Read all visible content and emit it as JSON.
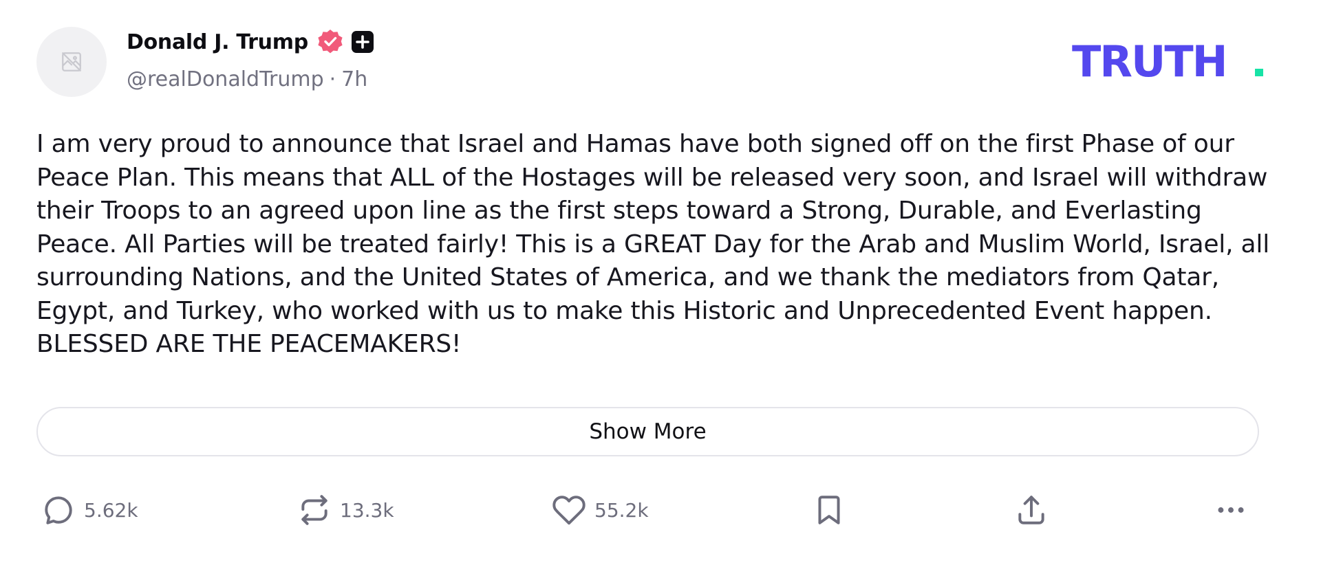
{
  "author": {
    "display_name": "Donald J. Trump",
    "handle": "@realDonaldTrump",
    "separator": "·",
    "timestamp": "7h",
    "avatar_icon": "broken-image-icon",
    "badges": [
      "verified-badge-icon",
      "plus-badge-icon"
    ]
  },
  "brand": {
    "logo_text": "TRUTH",
    "logo_color": "#5448ee",
    "dot_color": "#17e3a6"
  },
  "post": {
    "text": "I am very proud to announce that Israel and Hamas have both signed off on the first Phase of our Peace Plan. This means that ALL of the Hostages will be released very soon, and Israel will withdraw their Troops to an agreed upon line as the first steps toward a Strong, Durable, and Everlasting Peace. All Parties will be treated fairly! This is a GREAT Day for the Arab and Muslim World, Israel, all surrounding Nations, and the United States of America, and we thank the mediators from Qatar, Egypt, and Turkey, who worked with us to make this Historic and Unprecedented Event happen. BLESSED ARE THE PEACEMAKERS!",
    "show_more_label": "Show More"
  },
  "actions": {
    "replies": "5.62k",
    "retruths": "13.3k",
    "likes": "55.2k",
    "icons": [
      "reply-icon",
      "retruth-icon",
      "like-icon",
      "bookmark-icon",
      "share-icon",
      "more-icon"
    ]
  },
  "colors": {
    "verified": "#f15a7a",
    "icon": "#6d6d7c",
    "text": "#17171f"
  }
}
